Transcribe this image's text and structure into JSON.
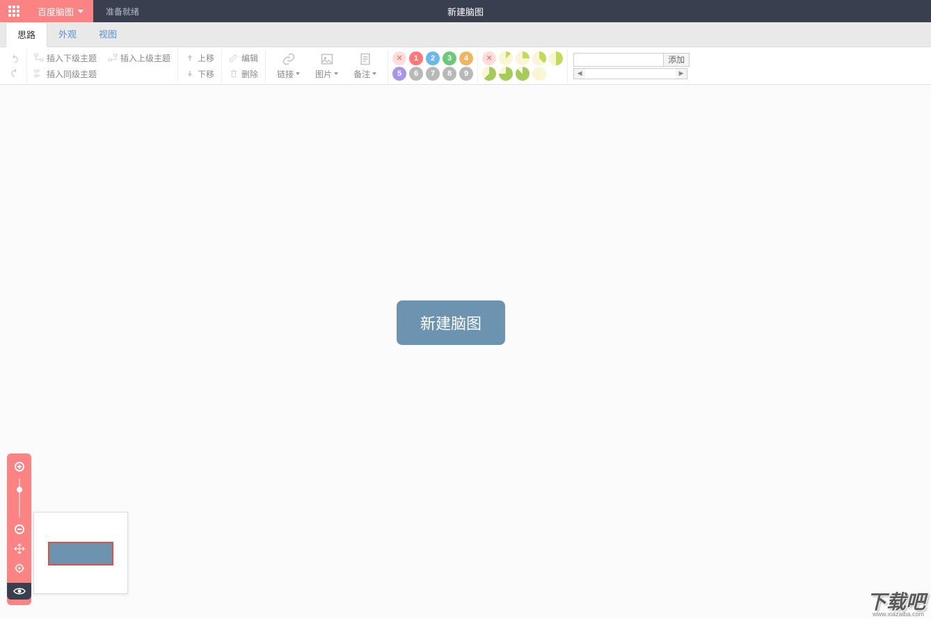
{
  "header": {
    "brand": "百度脑图",
    "status": "准备就绪",
    "doc_title": "新建脑图"
  },
  "tabs": {
    "items": [
      "思路",
      "外观",
      "视图"
    ],
    "active_index": 0
  },
  "toolbar": {
    "insert_child": "插入下级主题",
    "insert_parent": "插入上级主题",
    "insert_sibling": "插入同级主题",
    "move_up": "上移",
    "move_down": "下移",
    "edit": "编辑",
    "delete": "删除",
    "link": "链接",
    "image": "图片",
    "note": "备注",
    "priority_badges_top": [
      "1",
      "2",
      "3",
      "4"
    ],
    "priority_badges_bottom": [
      "5",
      "6",
      "7",
      "8",
      "9"
    ],
    "resource_add": "添加"
  },
  "canvas": {
    "root_node_text": "新建脑图"
  },
  "watermark": {
    "main": "下载吧",
    "sub": "www.xiazaiba.com"
  },
  "icons": {
    "apps": "apps-grid-icon",
    "undo": "undo-icon",
    "redo": "redo-icon",
    "link": "link-icon",
    "image": "image-icon",
    "note": "note-icon",
    "zoom_in": "zoom-in-icon",
    "zoom_out": "zoom-out-icon",
    "move": "move-icon",
    "target": "target-icon",
    "eye": "eye-icon"
  }
}
